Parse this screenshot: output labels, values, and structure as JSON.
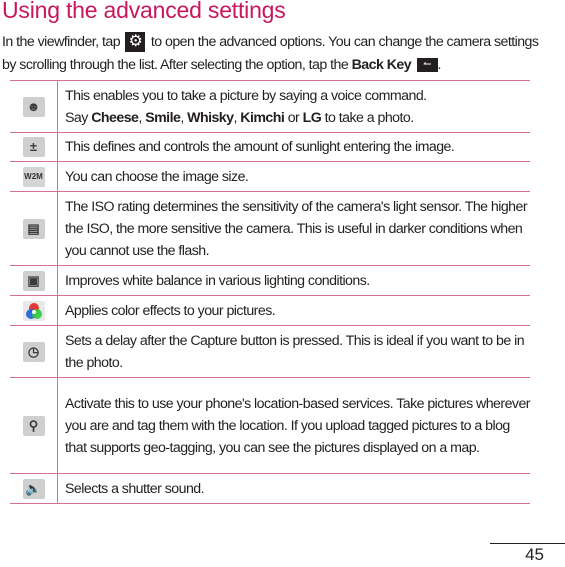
{
  "page": {
    "title": "Using the advanced settings",
    "intro": {
      "part1": "In the viewfinder, tap",
      "gear_icon": "settings-gear-icon",
      "part2": "to open the advanced options. You can change the camera settings by scrolling through the list. After selecting the option, tap the",
      "back_key_label": "Back Key",
      "back_icon": "back-key-icon",
      "part3": "."
    },
    "settings": [
      {
        "icon": "voice-shutter-icon",
        "text_a": "This enables you to take a picture by saying a voice command.",
        "text_b_prefix": "Say",
        "keywords": [
          "Cheese",
          "Smile",
          "Whisky",
          "Kimchi",
          "LG"
        ],
        "text_b_suffix": "to take a photo."
      },
      {
        "icon": "exposure-icon",
        "text": "This defines and controls the amount of sunlight entering the image."
      },
      {
        "icon": "image-size-icon",
        "icon_label": "W2M",
        "text": "You can choose the image size."
      },
      {
        "icon": "iso-icon",
        "text": "The ISO rating determines the sensitivity of the camera's light sensor. The higher the ISO, the more sensitive the camera. This is useful in darker conditions when you cannot use the flash."
      },
      {
        "icon": "white-balance-icon",
        "text": "Improves white balance in various lighting conditions."
      },
      {
        "icon": "color-effect-icon",
        "text": "Applies color effects to your pictures."
      },
      {
        "icon": "timer-icon",
        "text": "Sets a delay after the Capture button is pressed. This is ideal if you want to be in the photo."
      },
      {
        "icon": "geotagging-icon",
        "text": "Activate this to use your phone's location-based services. Take pictures wherever you are and tag them with the location. If you upload tagged pictures to a blog that supports geo-tagging, you can see the pictures displayed on a map."
      },
      {
        "icon": "shutter-sound-icon",
        "text": "Selects a shutter sound."
      }
    ],
    "page_number": "45",
    "colors": {
      "title": "#c8175d",
      "rule": "#d8708f",
      "text": "#231f20"
    }
  }
}
